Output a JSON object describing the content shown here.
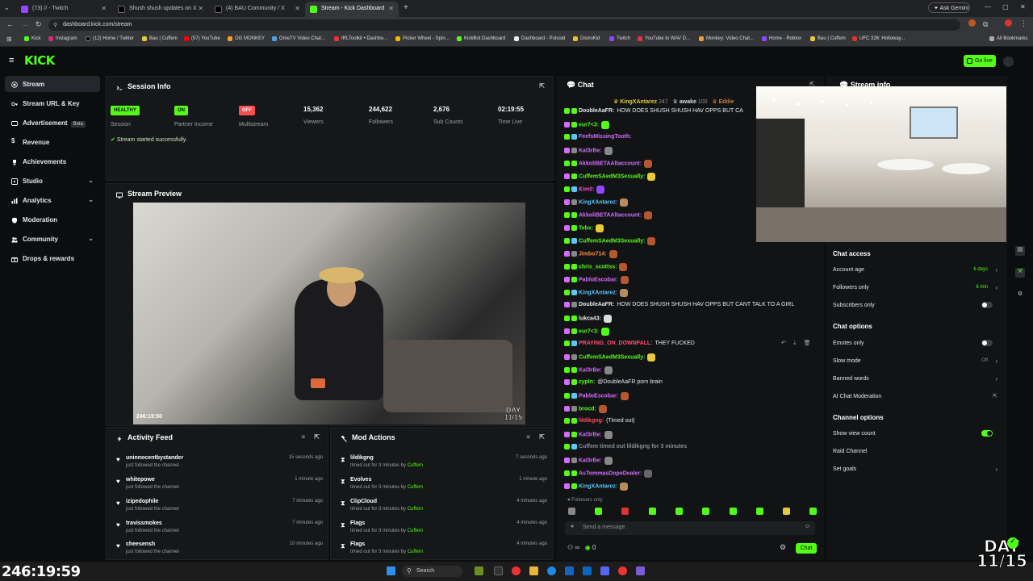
{
  "browser": {
    "tabs": [
      {
        "label": "(73) // - Twitch",
        "color": "#9146ff"
      },
      {
        "label": "Shush shush updates on X",
        "color": "#000000"
      },
      {
        "label": "(4) BAU Community / X",
        "color": "#000000"
      },
      {
        "label": "Stream - Kick Dashboard",
        "color": "#53fc18"
      }
    ],
    "url": "dashboard.kick.com/stream",
    "ask_gemini": "Ask Gemini",
    "bookmarks": [
      "Kick",
      "Instagram",
      "(12) Home / Twitter",
      "Bau | Cuffem",
      "(57) YouTube",
      "OG MONKEY",
      "OmeTV Video Chat...",
      "IRLToolkit • Dashbo...",
      "Picker Wheel - Spin...",
      "KickBot Dashboard",
      "Dashboard - Pulsoid",
      "DistroKid",
      "Twitch",
      "YouTube to WAV D...",
      "Monkey: Video Chat...",
      "Home - Roblox",
      "Bau | Cuffem",
      "UFC 326: Holloway..."
    ],
    "all_bookmarks": "All Bookmarks"
  },
  "kick": {
    "logo": "KICK",
    "go_live": "Go live"
  },
  "sidebar": {
    "items": [
      {
        "label": "Stream",
        "icon": "broadcast-icon",
        "chevron": ""
      },
      {
        "label": "Stream URL & Key",
        "icon": "key-icon",
        "chevron": ""
      },
      {
        "label": "Advertisement",
        "icon": "ad-icon",
        "chevron": "",
        "badge": "Beta"
      },
      {
        "label": "Revenue",
        "icon": "dollar-icon",
        "chevron": ""
      },
      {
        "label": "Achievements",
        "icon": "trophy-icon",
        "chevron": ""
      },
      {
        "label": "Studio",
        "icon": "studio-icon",
        "chevron": "⌄"
      },
      {
        "label": "Analytics",
        "icon": "analytics-icon",
        "chevron": "⌄"
      },
      {
        "label": "Moderation",
        "icon": "shield-icon",
        "chevron": ""
      },
      {
        "label": "Community",
        "icon": "users-icon",
        "chevron": "⌄"
      },
      {
        "label": "Drops & rewards",
        "icon": "gift-icon",
        "chevron": ""
      }
    ]
  },
  "session": {
    "title": "Session Info",
    "stats": [
      {
        "badge": "HEALTHY",
        "label": "Session",
        "badge_color": "#53fc18"
      },
      {
        "badge": "ON",
        "label": "Partner Income",
        "badge_color": "#53fc18"
      },
      {
        "badge": "OFF",
        "label": "Multistream",
        "badge_color": "#ff4d4d"
      },
      {
        "value": "15,362",
        "label": "Viewers"
      },
      {
        "value": "244,622",
        "label": "Followers"
      },
      {
        "value": "2,676",
        "label": "Sub Counts"
      },
      {
        "value": "02:19:55",
        "label": "Time Live"
      }
    ],
    "status": "Stream started successfully."
  },
  "preview": {
    "title": "Stream Preview",
    "timestamp": "246:19:50",
    "day": "DAY",
    "day_num": "11/15"
  },
  "activity": {
    "title": "Activity Feed",
    "rows": [
      {
        "name": "uninnocentbystander",
        "sub": "just followed the channel",
        "time": "15 seconds ago"
      },
      {
        "name": "whitepowe",
        "sub": "just followed the channel",
        "time": "1 minute ago"
      },
      {
        "name": "izipedophile",
        "sub": "just followed the channel",
        "time": "7 minutes ago"
      },
      {
        "name": "travissmokes",
        "sub": "just followed the channel",
        "time": "7 minutes ago"
      },
      {
        "name": "cheesensh",
        "sub": "just followed the channel",
        "time": "10 minutes ago"
      }
    ]
  },
  "mod_actions": {
    "title": "Mod Actions",
    "rows": [
      {
        "name": "lildikgng",
        "sub": "timed out for 3 minutes by",
        "by": "Cuffem",
        "time": "7 seconds ago"
      },
      {
        "name": "Evolves",
        "sub": "timed out for 3 minutes by",
        "by": "Cuffem",
        "time": "1 minute ago"
      },
      {
        "name": "ClipCloud",
        "sub": "timed out for 3 minutes by",
        "by": "Cuffem",
        "time": "4 minutes ago"
      },
      {
        "name": "Flags",
        "sub": "timed out for 3 minutes by",
        "by": "Cuffem",
        "time": "4 minutes ago"
      },
      {
        "name": "Flags",
        "sub": "timed out for 3 minutes by",
        "by": "Cuffem",
        "time": "4 minutes ago"
      }
    ]
  },
  "chat": {
    "title": "Chat",
    "pinned": [
      {
        "user": "KingXAntarez",
        "count": "247"
      },
      {
        "user": "awake",
        "count": "100"
      },
      {
        "user": "Eddie",
        "count": ""
      }
    ],
    "messages": [
      {
        "user": "DoubleAaFR:",
        "msg": "HOW DOES SHUSH SHUSH HAV OPPS BUT CA",
        "color": "#e6e8ea",
        "emote": ""
      },
      {
        "user": "eur7<3:",
        "msg": "",
        "color": "#53fc18",
        "emote": "#53fc18"
      },
      {
        "user": "FeefsMissingTooth:",
        "msg": "",
        "color": "#d46cff",
        "emote": ""
      },
      {
        "user": "Kal3rBe:",
        "msg": "",
        "color": "#d46cff",
        "emote": "#888888"
      },
      {
        "user": "AkkoliBETAAltaccount:",
        "msg": "",
        "color": "#d46cff",
        "emote": "#b5572f"
      },
      {
        "user": "CuffemSAedM3Sexually:",
        "msg": "",
        "color": "#53fc18",
        "emote": "#e8c93a"
      },
      {
        "user": "Kim0:",
        "msg": "",
        "color": "#ff4dd2",
        "emote": "#9146ff"
      },
      {
        "user": "KingXAntarez:",
        "msg": "",
        "color": "#5ac8fa",
        "emote": "#b58b5f"
      },
      {
        "user": "AkkoliBETAAltaccount:",
        "msg": "",
        "color": "#d46cff",
        "emote": "#b5572f"
      },
      {
        "user": "Tebx:",
        "msg": "",
        "color": "#53fc18",
        "emote": "#e8c93a"
      },
      {
        "user": "CuffemSAedM3Sexually:",
        "msg": "",
        "color": "#53fc18",
        "emote": "#b5572f"
      },
      {
        "user": "Jimbo714:",
        "msg": "",
        "color": "#ff8a3d",
        "emote": "#b5572f"
      },
      {
        "user": "chris_scottss:",
        "msg": "",
        "color": "#53fc18",
        "emote": "#b5572f"
      },
      {
        "user": "PabloEscobar:",
        "msg": "",
        "color": "#d46cff",
        "emote": "#b5572f"
      },
      {
        "user": "KingXAntarez:",
        "msg": "",
        "color": "#5ac8fa",
        "emote": "#b58b5f"
      },
      {
        "user": "DoubleAaFR:",
        "msg": "HOW DOES SHUSH SHUSH HAV OPPS BUT CANT TALK TO A GIRL",
        "color": "#e6e8ea",
        "emote": ""
      },
      {
        "user": "lukca43:",
        "msg": "",
        "color": "#e6e8ea",
        "emote": "#dddddd"
      },
      {
        "user": "eur7<3:",
        "msg": "",
        "color": "#53fc18",
        "emote": "#53fc18"
      },
      {
        "user": "PRAYING_ON_DOWNFALL:",
        "msg": "THEY FUCKED",
        "color": "#ff4d6d",
        "emote": ""
      },
      {
        "user": "CuffemSAedM3Sexually:",
        "msg": "",
        "color": "#53fc18",
        "emote": "#e8c93a"
      },
      {
        "user": "Kal3rBe:",
        "msg": "",
        "color": "#d46cff",
        "emote": "#888888"
      },
      {
        "user": "zypln:",
        "msg": "@DoubleAaFR porn brain",
        "color": "#53fc18",
        "emote": ""
      },
      {
        "user": "PabloEscobar:",
        "msg": "",
        "color": "#d46cff",
        "emote": "#b5572f"
      },
      {
        "user": "brocd:",
        "msg": "",
        "color": "#53fc18",
        "emote": "#b5572f"
      },
      {
        "user": "lildikgng:",
        "msg": "(Timed out)",
        "color": "#ff4d6d",
        "emote": ""
      },
      {
        "user": "Kal3rBe:",
        "msg": "",
        "color": "#d46cff",
        "emote": "#888888"
      },
      {
        "user": "Cuffem timed out lildikgng for 3 minutes",
        "msg": "",
        "color": "#8a9096",
        "emote": ""
      },
      {
        "user": "Kal3rBe:",
        "msg": "",
        "color": "#d46cff",
        "emote": "#888888"
      },
      {
        "user": "AsTommasDopeDealer:",
        "msg": "",
        "color": "#d46cff",
        "emote": "#666666"
      },
      {
        "user": "KingXAntarez:",
        "msg": "",
        "color": "#5ac8fa",
        "emote": "#b58b5f"
      }
    ],
    "followers_only": "Followers only",
    "input_placeholder": "Send a message",
    "send_label": "Chat",
    "count": "0"
  },
  "right": {
    "stream_info_label": "Stream info",
    "chat_access_title": "Chat access",
    "chat_access": [
      {
        "label": "Account age",
        "value": "6 days",
        "type": "link"
      },
      {
        "label": "Followers only",
        "value": "6 min",
        "type": "link"
      },
      {
        "label": "Subscribers only",
        "value": "",
        "type": "toggle-off"
      }
    ],
    "chat_options_title": "Chat options",
    "chat_options": [
      {
        "label": "Emotes only",
        "value": "",
        "type": "toggle-off"
      },
      {
        "label": "Slow mode",
        "value": "Off",
        "type": "link-grey"
      },
      {
        "label": "Banned words",
        "value": "",
        "type": "link"
      },
      {
        "label": "AI Chat Moderation",
        "value": "",
        "type": "external"
      }
    ],
    "channel_options_title": "Channel options",
    "channel_options": [
      {
        "label": "Show view count",
        "value": "",
        "type": "toggle-on"
      },
      {
        "label": "Raid Channel",
        "value": "",
        "type": "none"
      },
      {
        "label": "Set goals",
        "value": "",
        "type": "link"
      }
    ]
  },
  "overlay": {
    "timer": "246:19:59",
    "day": "DAY",
    "day_num": "11/15"
  },
  "taskbar": {
    "search": "Search"
  }
}
